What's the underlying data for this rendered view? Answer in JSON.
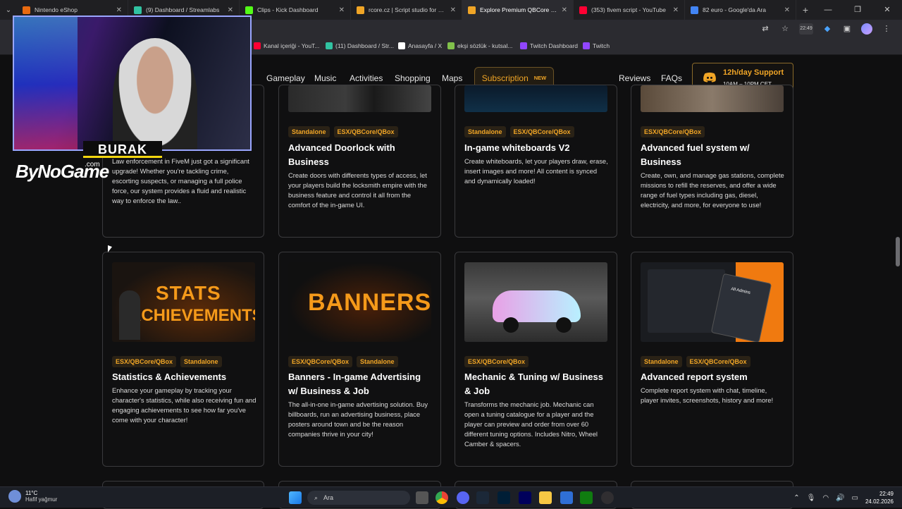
{
  "browser": {
    "tabs": [
      {
        "title": "Nintendo eShop",
        "color": "#e86a10"
      },
      {
        "title": "(9) Dashboard / Streamlabs",
        "color": "#31c3a2"
      },
      {
        "title": "Clips - Kick Dashboard",
        "color": "#53fc18"
      },
      {
        "title": "rcore.cz | Script studio for your",
        "color": "#f0a526"
      },
      {
        "title": "Explore Premium QBCore and E",
        "color": "#f0a526"
      },
      {
        "title": "(353) fivem script - YouTube",
        "color": "#ff0033"
      },
      {
        "title": "82 euro - Google'da Ara",
        "color": "#4285f4"
      }
    ],
    "time_badge": "22:49",
    "bookmarks": [
      {
        "label": "Kanal içeriği - YouT...",
        "color": "#ff0033"
      },
      {
        "label": "(11) Dashboard / Str...",
        "color": "#31c3a2"
      },
      {
        "label": "Anasayfa / X",
        "color": "#ffffff"
      },
      {
        "label": "ekşi sözlük - kutsal...",
        "color": "#81c14b"
      },
      {
        "label": "Twitch Dashboard",
        "color": "#9146ff"
      },
      {
        "label": "Twitch",
        "color": "#9146ff"
      }
    ]
  },
  "site": {
    "nav": [
      "Gameplay",
      "Music",
      "Activities",
      "Shopping",
      "Maps"
    ],
    "subscription": {
      "label": "Subscription",
      "badge": "NEW"
    },
    "nav_right": [
      "Reviews",
      "FAQs"
    ],
    "support": {
      "line1": "12h/day Support",
      "line2": "10AM – 10PM CET"
    },
    "accent": "#f0a526"
  },
  "cards_row1": [
    {
      "tags": [],
      "title": "",
      "desc": "Law enforcement in FiveM just got a significant upgrade! Whether you're tackling crime, escorting suspects, or managing a full police force, our system provides a fluid and realistic way to enforce the law.."
    },
    {
      "tags": [
        "Standalone",
        "ESX/QBCore/QBox"
      ],
      "title": "Advanced Doorlock with Business",
      "desc": "Create doors with differents types of access, let your players build the locksmith empire with the business feature and control it all from the comfort of the in-game UI."
    },
    {
      "tags": [
        "Standalone",
        "ESX/QBCore/QBox"
      ],
      "title": "In-game whiteboards V2",
      "desc": "Create whiteboards, let your players draw, erase, insert images and more! All content is synced and dynamically loaded!"
    },
    {
      "tags": [
        "ESX/QBCore/QBox"
      ],
      "title": "Advanced fuel system w/ Business",
      "desc": "Create, own, and manage gas stations, complete missions to refill the reserves, and offer a wide range of fuel types including gas, diesel, electricity, and more, for everyone to use!"
    }
  ],
  "cards_row2": [
    {
      "tags": [
        "ESX/QBCore/QBox",
        "Standalone"
      ],
      "title": "Statistics & Achievements",
      "desc": "Enhance your gameplay by tracking your character's statistics, while also receiving fun and engaging achievements to see how far you've come with your character!",
      "thumb_text1": "STATS",
      "thumb_text2": "ACHIEVEMENTS"
    },
    {
      "tags": [
        "ESX/QBCore/QBox",
        "Standalone"
      ],
      "title": "Banners - In-game Advertising w/ Business & Job",
      "desc": "The all-in-one in-game advertising solution. Buy billboards, run an advertising business, place posters around town and be the reason companies thrive in your city!",
      "thumb_text1": "BANNERS",
      "thumb_text2": ""
    },
    {
      "tags": [
        "ESX/QBCore/QBox"
      ],
      "title": "Mechanic & Tuning w/ Business & Job",
      "desc": "Transforms the mechanic job. Mechanic can open a tuning catalogue for a player and the player can preview and order from over 60 different tuning options. Includes Nitro, Wheel Camber & spacers.",
      "thumb_text1": "",
      "thumb_text2": ""
    },
    {
      "tags": [
        "Standalone",
        "ESX/QBCore/QBox"
      ],
      "title": "Advanced report system",
      "desc": "Complete report system with chat, timeline, player invites, screenshots, history and more!",
      "thumb_text1": "All Admins",
      "thumb_text2": ""
    }
  ],
  "overlay": {
    "streamer": "BURAK",
    "brand": "ByNoGame",
    "brand_suffix": ".com"
  },
  "taskbar": {
    "temp": "11°C",
    "weather": "Hafif yağmur",
    "search": "Ara",
    "time": "22:49",
    "date": "24.02.2026"
  }
}
